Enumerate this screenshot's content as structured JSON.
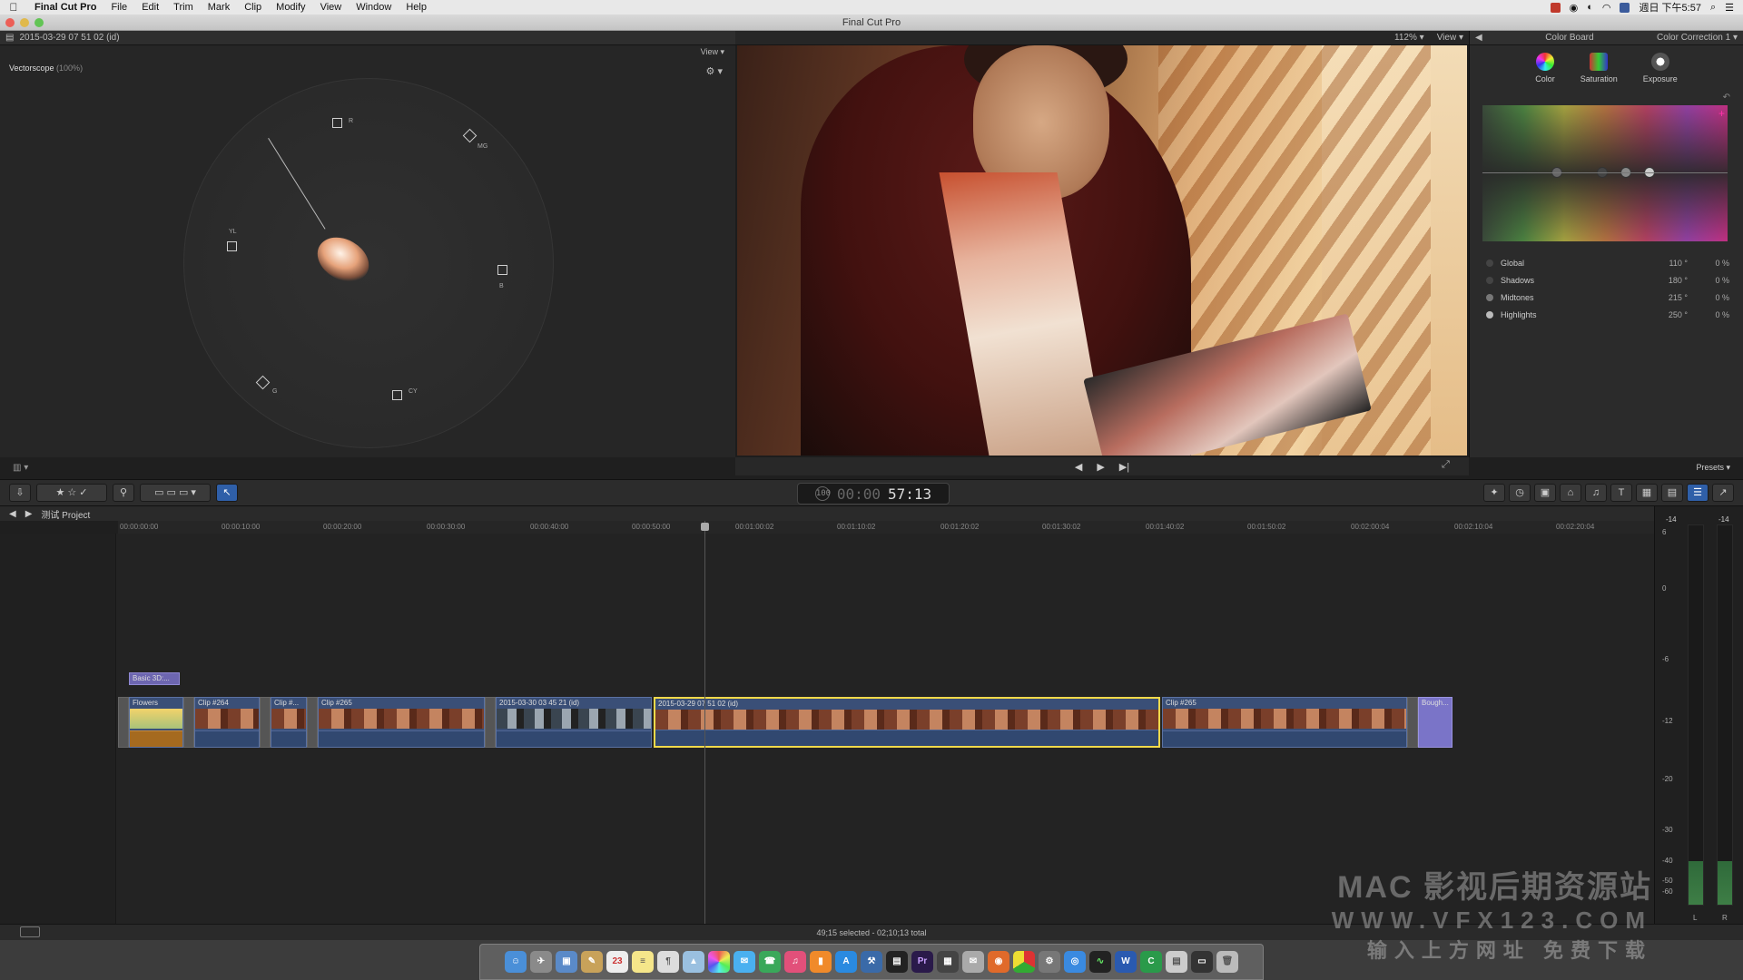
{
  "menubar": {
    "app": "Final Cut Pro",
    "items": [
      "File",
      "Edit",
      "Trim",
      "Mark",
      "Clip",
      "Modify",
      "View",
      "Window",
      "Help"
    ],
    "clock": "週日 下午5:57"
  },
  "window": {
    "title": "Final Cut Pro"
  },
  "scopes": {
    "clip_name": "2015-03-29 07 51 02 (id)",
    "view_label": "View",
    "scope_label": "Vectorscope",
    "scope_zoom": "(100%)",
    "targets": [
      "R",
      "MG",
      "B",
      "CY",
      "G",
      "YL"
    ]
  },
  "viewer": {
    "zoom": "112%",
    "view_label": "View"
  },
  "inspector": {
    "title": "Color Board",
    "effect": "Color Correction 1",
    "tabs": [
      "Color",
      "Saturation",
      "Exposure"
    ],
    "rows": [
      {
        "name": "Global",
        "deg": "110 °",
        "pct": "0 %"
      },
      {
        "name": "Shadows",
        "deg": "180 °",
        "pct": "0 %"
      },
      {
        "name": "Midtones",
        "deg": "215 °",
        "pct": "0 %"
      },
      {
        "name": "Highlights",
        "deg": "250 °",
        "pct": "0 %"
      }
    ],
    "presets": "Presets"
  },
  "toolbar": {
    "timecode": "57:13",
    "timecode_prefix": "00:00",
    "tc_badge": "100"
  },
  "timeline": {
    "project": "测试 Project",
    "ruler": [
      "00:00:00:00",
      "00:00:10:00",
      "00:00:20:00",
      "00:00:30:00",
      "00:00:40:00",
      "00:00:50:00",
      "00:01:00:02",
      "00:01:10:02",
      "00:01:20:02",
      "00:01:30:02",
      "00:01:40:02",
      "00:01:50:02",
      "00:02:00:04",
      "00:02:10:04",
      "00:02:20:04"
    ],
    "title_clip": "Basic 3D:...",
    "clips": [
      "Flowers",
      "Clip #264",
      "Clip #...",
      "Clip #265",
      "2015-03-30 03 45 21 (id)",
      "2015-03-29 07 51 02 (id)",
      "Clip #265",
      "Bough..."
    ]
  },
  "meters": {
    "scale": [
      "6",
      "0",
      "-6",
      "-12",
      "-20",
      "-30",
      "-40",
      "-50",
      "-60"
    ],
    "top": [
      "-14",
      "-14"
    ],
    "channels": [
      "L",
      "R"
    ]
  },
  "status": {
    "text": "49;15 selected - 02;10;13 total"
  },
  "dock": {
    "icons": [
      "Finder",
      "Launchpad",
      "Preview",
      "Notes",
      "Calendar",
      "Notes2",
      "TextEdit",
      "Photos",
      "Photos2",
      "Messages",
      "iTunes",
      "iBooks",
      "App Store",
      "Xcode",
      "Final Cut Pro",
      "Premiere",
      "Motion",
      "Mail",
      "Firefox",
      "Chrome",
      "System Preferences",
      "Safari",
      "Activity Monitor",
      "Word",
      "Camtasia",
      "Downloads",
      "Terminal",
      "Trash"
    ],
    "calendar_day": "23",
    "pr_label": "Pr",
    "w_label": "W"
  },
  "watermark": {
    "line1": "MAC 影视后期资源站",
    "line2": "WWW.VFX123.COM",
    "line3": "输入上方网址 免费下载"
  },
  "colors": {
    "selection": "#f1d94a",
    "clip_blue": "#3a4f77",
    "title_purple": "#6d66b0",
    "active_tool": "#2f5fa8"
  }
}
